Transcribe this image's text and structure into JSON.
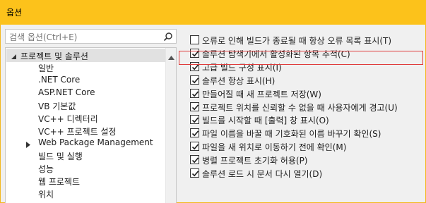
{
  "window": {
    "title": "옵션"
  },
  "search": {
    "placeholder": "검색 옵션(Ctrl+E)"
  },
  "tree": {
    "root_label": "프로젝트 및 솔루션",
    "items": [
      {
        "label": "일반"
      },
      {
        "label": ".NET Core"
      },
      {
        "label": "ASP.NET Core"
      },
      {
        "label": "VB 기본값"
      },
      {
        "label": "VC++ 디렉터리"
      },
      {
        "label": "VC++ 프로젝트 설정"
      },
      {
        "label": "Web Package Management",
        "collapsed": true
      },
      {
        "label": "빌드 및 실행"
      },
      {
        "label": "성능"
      },
      {
        "label": "웹 프로젝트"
      },
      {
        "label": "위치"
      }
    ]
  },
  "options": [
    {
      "label": "오류로 인해 빌드가 종료될 때 항상 오류 목록 표시(T)",
      "checked": false
    },
    {
      "label": "솔루션 탐색기에서 활성화된 항목 추적(C)",
      "checked": true
    },
    {
      "label": "고급 빌드 구성 표시(I)",
      "checked": true
    },
    {
      "label": "솔루션 항상 표시(H)",
      "checked": true
    },
    {
      "label": "만들어질 때 새 프로젝트 저장(W)",
      "checked": true
    },
    {
      "label": "프로젝트 위치를 신뢰할 수 없을 때 사용자에게 경고(U)",
      "checked": true
    },
    {
      "label": "빌드를 시작할 때 [출력] 창 표시(O)",
      "checked": true
    },
    {
      "label": "파일 이름을 바꿀 때 기호화된 이름 바꾸기 확인(S)",
      "checked": true
    },
    {
      "label": "파일을 새 위치로 이동하기 전에 확인(M)",
      "checked": true
    },
    {
      "label": "병렬 프로젝트 초기화 허용(P)",
      "checked": true
    },
    {
      "label": "솔루션 로드 시 문서 다시 열기(D)",
      "checked": true
    }
  ],
  "colors": {
    "titlebar": "#fcc21b",
    "highlight_border": "#e03c3c",
    "tree_selected": "#e1e1e1"
  }
}
